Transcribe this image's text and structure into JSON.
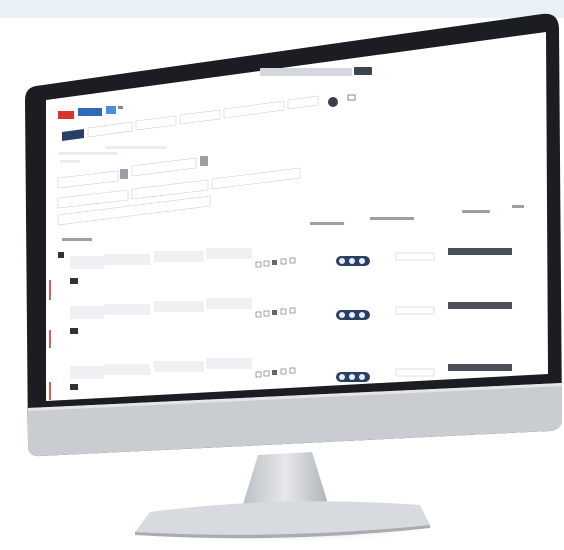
{
  "app": {
    "toolbar_labels": [
      "",
      "",
      "",
      ""
    ],
    "tabs": [
      "",
      "",
      "",
      "",
      "",
      ""
    ],
    "section_labels": {
      "category": "",
      "send_to_location": "",
      "single_actions": ""
    },
    "rows": [
      {
        "id": "r1"
      },
      {
        "id": "r2"
      },
      {
        "id": "r3"
      }
    ]
  },
  "colors": {
    "bezel": "#1b1d22",
    "screen_bg": "#ffffff",
    "accent_red": "#d9332b",
    "accent_blue": "#2f6bb3",
    "nav_dark": "#2a3f66",
    "stand": "#c8ccd1"
  },
  "icons": [
    "close-icon",
    "gear-icon",
    "user-icon",
    "search-icon",
    "print-icon",
    "mail-icon",
    "trash-icon",
    "edit-icon"
  ]
}
